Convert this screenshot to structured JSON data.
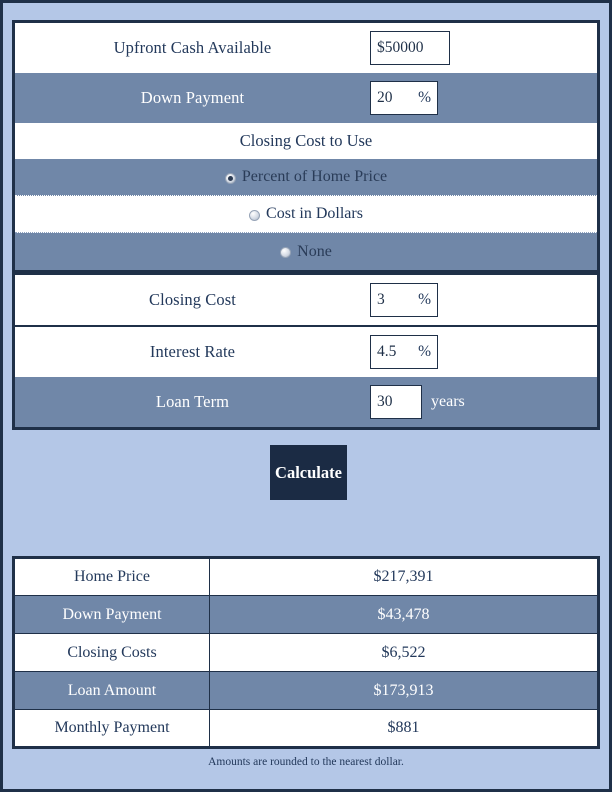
{
  "form": {
    "rows": [
      {
        "name": "upfront-cash",
        "label": "Upfront Cash Available",
        "value": "$50000",
        "unit": "",
        "suffix": "",
        "shade": "light",
        "field": "wide"
      },
      {
        "name": "down-payment",
        "label": "Down Payment",
        "value": "20",
        "unit": "%",
        "suffix": "",
        "shade": "dark",
        "field": "pct"
      }
    ],
    "closing_cost_group": {
      "title": "Closing Cost to Use",
      "options": [
        {
          "label": "Percent of Home Price",
          "checked": true,
          "shade": "dark"
        },
        {
          "label": "Cost in Dollars",
          "checked": false,
          "shade": "light"
        },
        {
          "label": "None",
          "checked": false,
          "shade": "dark"
        }
      ]
    },
    "rows2": [
      {
        "name": "closing-cost",
        "label": "Closing Cost",
        "value": "3",
        "unit": "%",
        "suffix": "",
        "shade": "light",
        "field": "pct"
      },
      {
        "name": "interest-rate",
        "label": "Interest Rate",
        "value": "4.5",
        "unit": "%",
        "suffix": "",
        "shade": "light",
        "field": "pct"
      },
      {
        "name": "loan-term",
        "label": "Loan Term",
        "value": "30",
        "unit": "",
        "suffix": "years",
        "shade": "dark",
        "field": "term"
      }
    ]
  },
  "calculate_button": {
    "label": "Calculate"
  },
  "results": {
    "rows": [
      {
        "label": "Home Price",
        "value": "$217,391",
        "shade": "light"
      },
      {
        "label": "Down Payment",
        "value": "$43,478",
        "shade": "dark"
      },
      {
        "label": "Closing Costs",
        "value": "$6,522",
        "shade": "light"
      },
      {
        "label": "Loan Amount",
        "value": "$173,913",
        "shade": "dark"
      },
      {
        "label": "Monthly Payment",
        "value": "$881",
        "shade": "light"
      }
    ],
    "footnote": "Amounts are rounded to the nearest dollar."
  },
  "colors": {
    "page_background": "#b4c7e7",
    "frame_border": "#1f3048",
    "row_shade": "#7087a8",
    "button_background": "#1b2b44",
    "text_dark": "#23395b"
  }
}
